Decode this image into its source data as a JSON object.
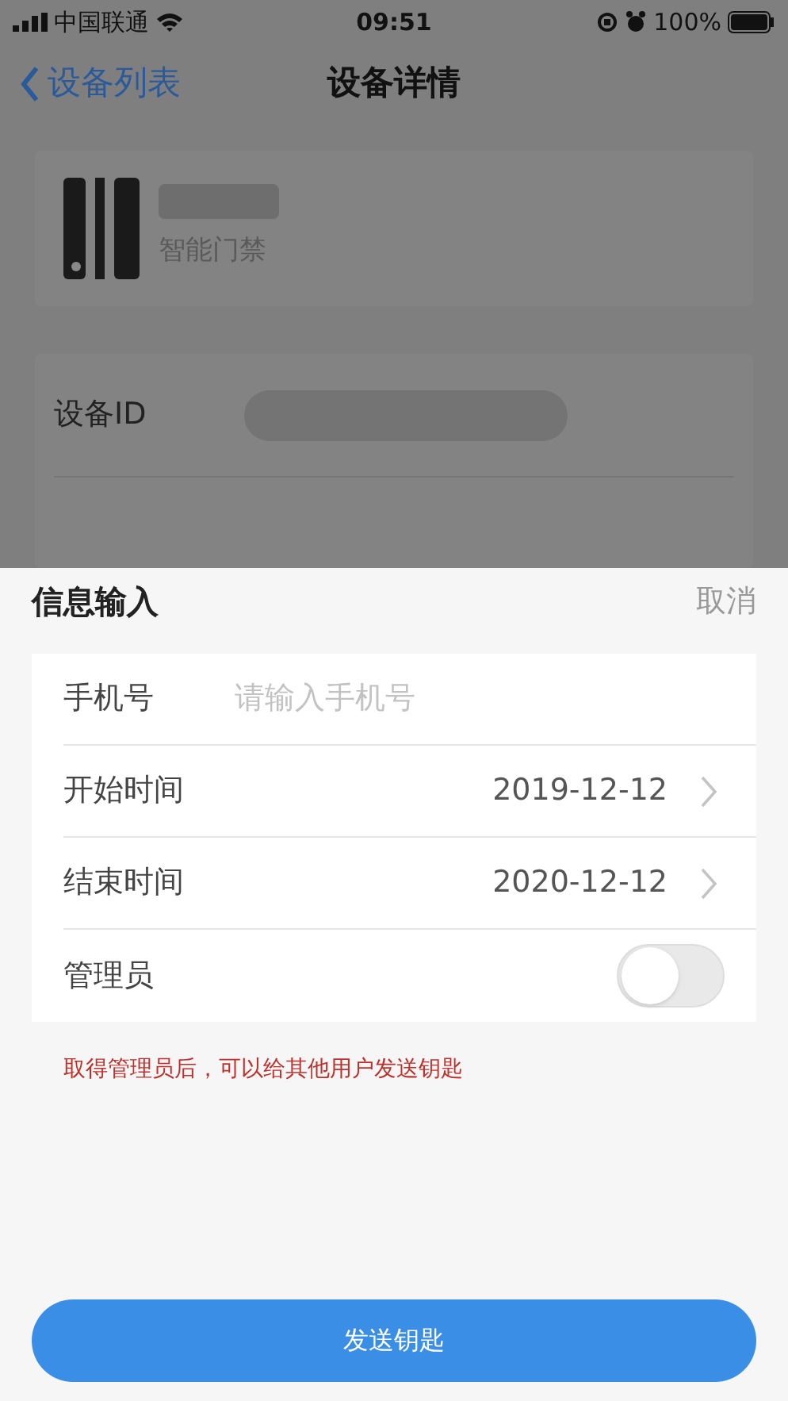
{
  "status_bar": {
    "carrier": "中国联通",
    "time": "09:51",
    "battery": "100%"
  },
  "nav": {
    "back": "设备列表",
    "title": "设备详情"
  },
  "device": {
    "type": "智能门禁"
  },
  "detail_rows": [
    {
      "label": "设备ID"
    }
  ],
  "sheet": {
    "title": "信息输入",
    "cancel": "取消",
    "fields": [
      {
        "kind": "input",
        "label": "手机号",
        "placeholder": "请输入手机号"
      },
      {
        "kind": "picker",
        "label": "开始时间",
        "value": "2019-12-12"
      },
      {
        "kind": "picker",
        "label": "结束时间",
        "value": "2020-12-12"
      },
      {
        "kind": "switch",
        "label": "管理员",
        "on": false
      }
    ],
    "hint": "取得管理员后，可以给其他用户发送钥匙",
    "button": "发送钥匙"
  }
}
